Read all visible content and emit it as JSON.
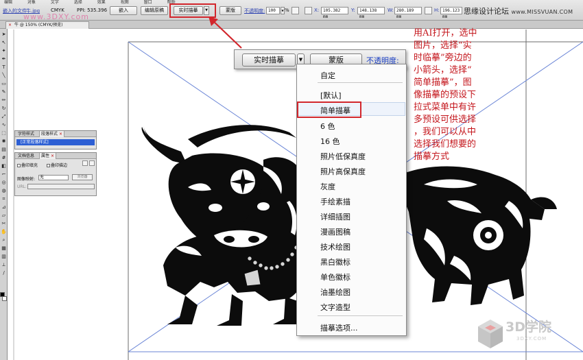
{
  "menubar": {
    "items": [
      "编辑",
      "对象",
      "文字",
      "选择",
      "效果",
      "视图",
      "窗口",
      "帮助"
    ]
  },
  "control_bar": {
    "doc_link": "嵌入的文件",
    "file_name": "牛.jpg",
    "color_mode": "CMYK",
    "ppi": "PPI: 535.396",
    "embed_label": "嵌入",
    "edit_original_label": "编辑原稿",
    "live_trace_label": "实时描摹",
    "mask_label": "蒙版",
    "opacity_label": "不透明度:",
    "opacity_value": "100",
    "percent": "%",
    "x_label": "X:",
    "x_value": "105.382 mm",
    "y_label": "Y:",
    "y_value": "148.138 mm",
    "w_label": "W:",
    "w_value": "280.189 mm",
    "h_label": "H:",
    "h_value": "196.123 mm"
  },
  "site_watermark": {
    "cn": "思缘设计论坛",
    "en": "www.MISSVUAN.COM"
  },
  "doc_tab": {
    "title": "牛 @ 150% (CMYK/预览)"
  },
  "watermark_3dxy": "www.3DXY.com",
  "char_styles_panel": {
    "tabs": [
      "字符样式",
      "段落样式"
    ],
    "selected_item": "[正常段落样式]"
  },
  "doc_info_panel": {
    "tabs": [
      "文档信息",
      "属性"
    ],
    "overprint_fill": "叠印填充",
    "overprint_stroke": "叠印描边",
    "image_map_label": "图像映射:",
    "image_map_value": "无",
    "browser_label": "浏览器",
    "url_label": "URL:"
  },
  "zoomed_bar": {
    "live_trace_label": "实时描摹",
    "mask_label": "蒙版",
    "opacity_label": "不透明度:"
  },
  "trace_dropdown": {
    "items": [
      "自定",
      "[默认]",
      "简单描摹",
      "6 色",
      "16 色",
      "照片低保真度",
      "照片高保真度",
      "灰度",
      "手绘素描",
      "详细插图",
      "漫画图稿",
      "技术绘图",
      "黑白徽标",
      "单色徽标",
      "油墨绘图",
      "文字造型",
      "描摹选项..."
    ],
    "selected": "简单描摹"
  },
  "annotation": {
    "lines": [
      "用AI打开，选中",
      "图片，选择“实",
      "时临摹”旁边的",
      "小箭头，选择“",
      "简单描摹”，图",
      "像描摹的预设下",
      "拉式菜单中有许",
      "多预设可供选择",
      "，我们可以从中",
      "选择我们想要的",
      "描摹方式"
    ]
  },
  "logo_3d": {
    "title": "3D学院",
    "url": "3DXY.COM"
  },
  "colors": {
    "highlight": "#d2262c",
    "annotation": "#c4161c",
    "link": "#1a3fc4",
    "selection": "#2d5fd4"
  }
}
